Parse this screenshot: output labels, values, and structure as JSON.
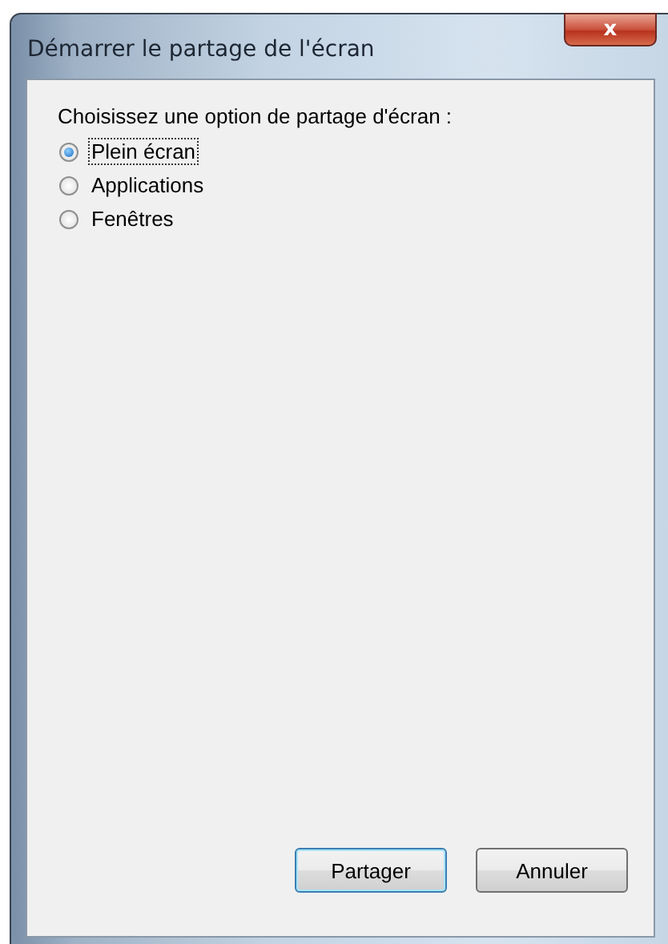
{
  "window": {
    "title": "Démarrer le partage de l'écran",
    "close": "x"
  },
  "prompt": "Choisissez une option de partage d'écran :",
  "options": [
    {
      "label": "Plein écran",
      "selected": true
    },
    {
      "label": "Applications",
      "selected": false
    },
    {
      "label": "Fenêtres",
      "selected": false
    }
  ],
  "buttons": [
    {
      "label": "Partager",
      "default": true
    },
    {
      "label": "Annuler",
      "default": false
    }
  ]
}
